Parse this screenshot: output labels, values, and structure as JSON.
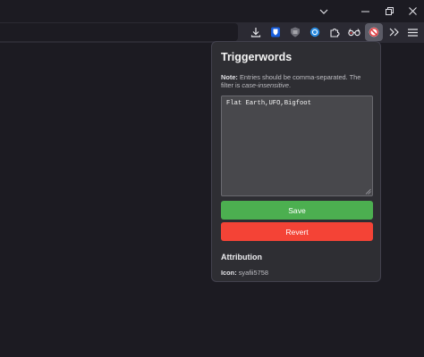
{
  "window": {
    "controls": [
      {
        "name": "list-all-tabs",
        "icon": "chevron-down-icon"
      },
      {
        "name": "minimize",
        "icon": "minimize-icon"
      },
      {
        "name": "restore",
        "icon": "restore-icon"
      },
      {
        "name": "close",
        "icon": "close-icon"
      }
    ]
  },
  "toolbar": {
    "buttons": [
      {
        "name": "downloads",
        "icon": "download-icon"
      },
      {
        "name": "bitwarden",
        "icon": "bitwarden-shield-icon",
        "color": "#175ddc"
      },
      {
        "name": "privacy-badger",
        "icon": "shield-badge-icon"
      },
      {
        "name": "extension-blue",
        "icon": "circle-icon",
        "color": "#2a8be0"
      },
      {
        "name": "extensions",
        "icon": "puzzle-icon"
      },
      {
        "name": "extension-glasses",
        "icon": "glasses-icon"
      },
      {
        "name": "triggerwords-extension",
        "icon": "no-entry-icon",
        "active": true,
        "color": "#e0393e"
      },
      {
        "name": "more-tools",
        "icon": "double-chevron-right-icon"
      },
      {
        "name": "app-menu",
        "icon": "hamburger-menu-icon"
      }
    ]
  },
  "popup": {
    "title": "Triggerwords",
    "note_label": "Note:",
    "note_text": " Entries should be comma-separated. The filter is ",
    "note_emphasis": "case-insensitive",
    "note_end": ".",
    "textarea_value": "Flat Earth,UFO,Bigfoot",
    "save_label": "Save",
    "revert_label": "Revert",
    "attribution_title": "Attribution",
    "icon_label": "Icon:",
    "icon_author": "syafii5758",
    "colors": {
      "save": "#4caf50",
      "revert": "#f44336",
      "background": "#2e2e33"
    }
  }
}
